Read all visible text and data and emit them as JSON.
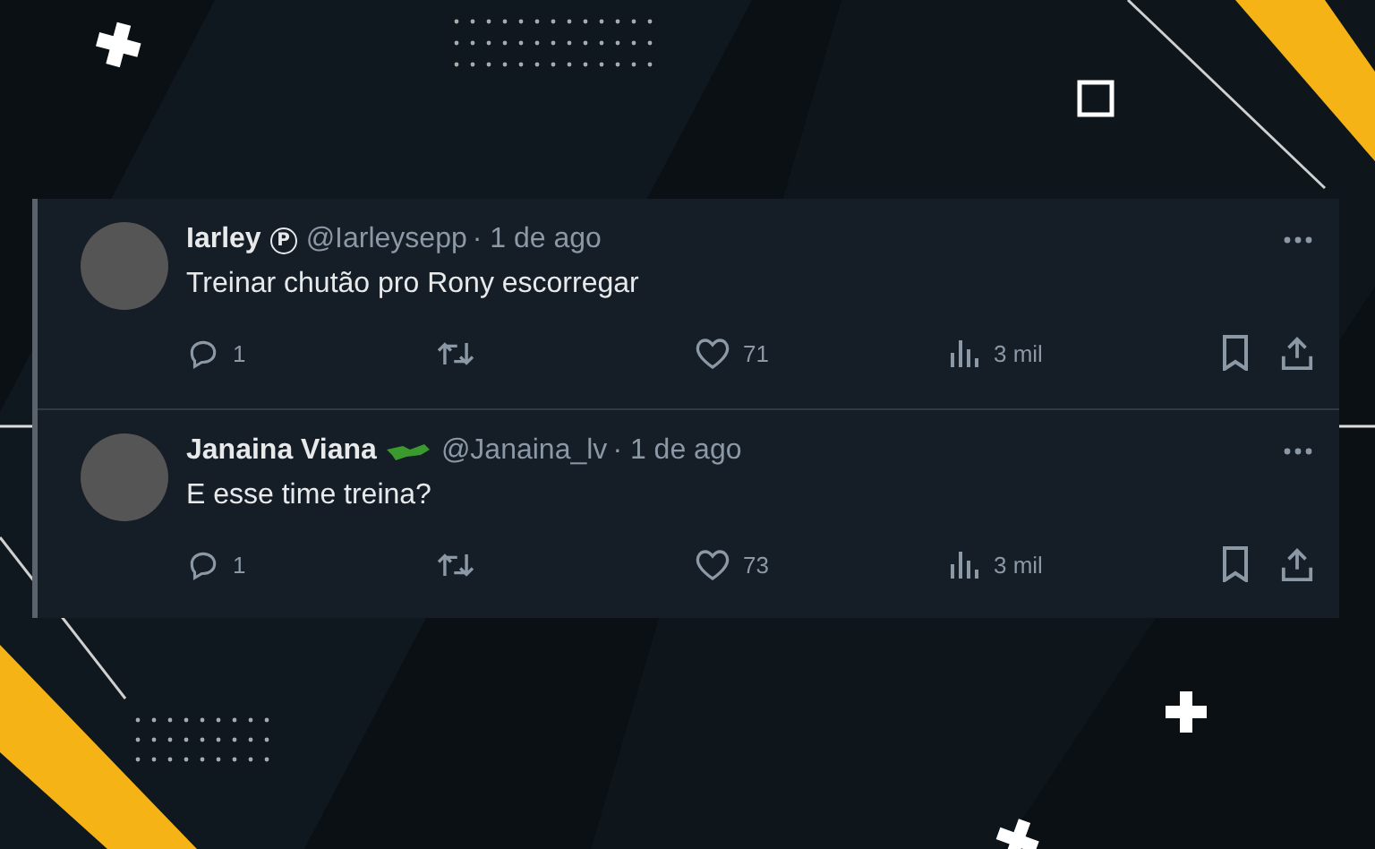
{
  "tweets": [
    {
      "name": "Iarley",
      "badge": "P",
      "handle": "@Iarleysepp",
      "time": "· 1 de ago",
      "text": "Treinar chutão pro Rony escorregar",
      "replies": "1",
      "likes": "71",
      "views": "3 mil"
    },
    {
      "name": "Janaina Viana",
      "handle": "@Janaina_lv",
      "time": "· 1 de ago",
      "text": "E esse time treina?",
      "replies": "1",
      "likes": "73",
      "views": "3 mil"
    }
  ]
}
